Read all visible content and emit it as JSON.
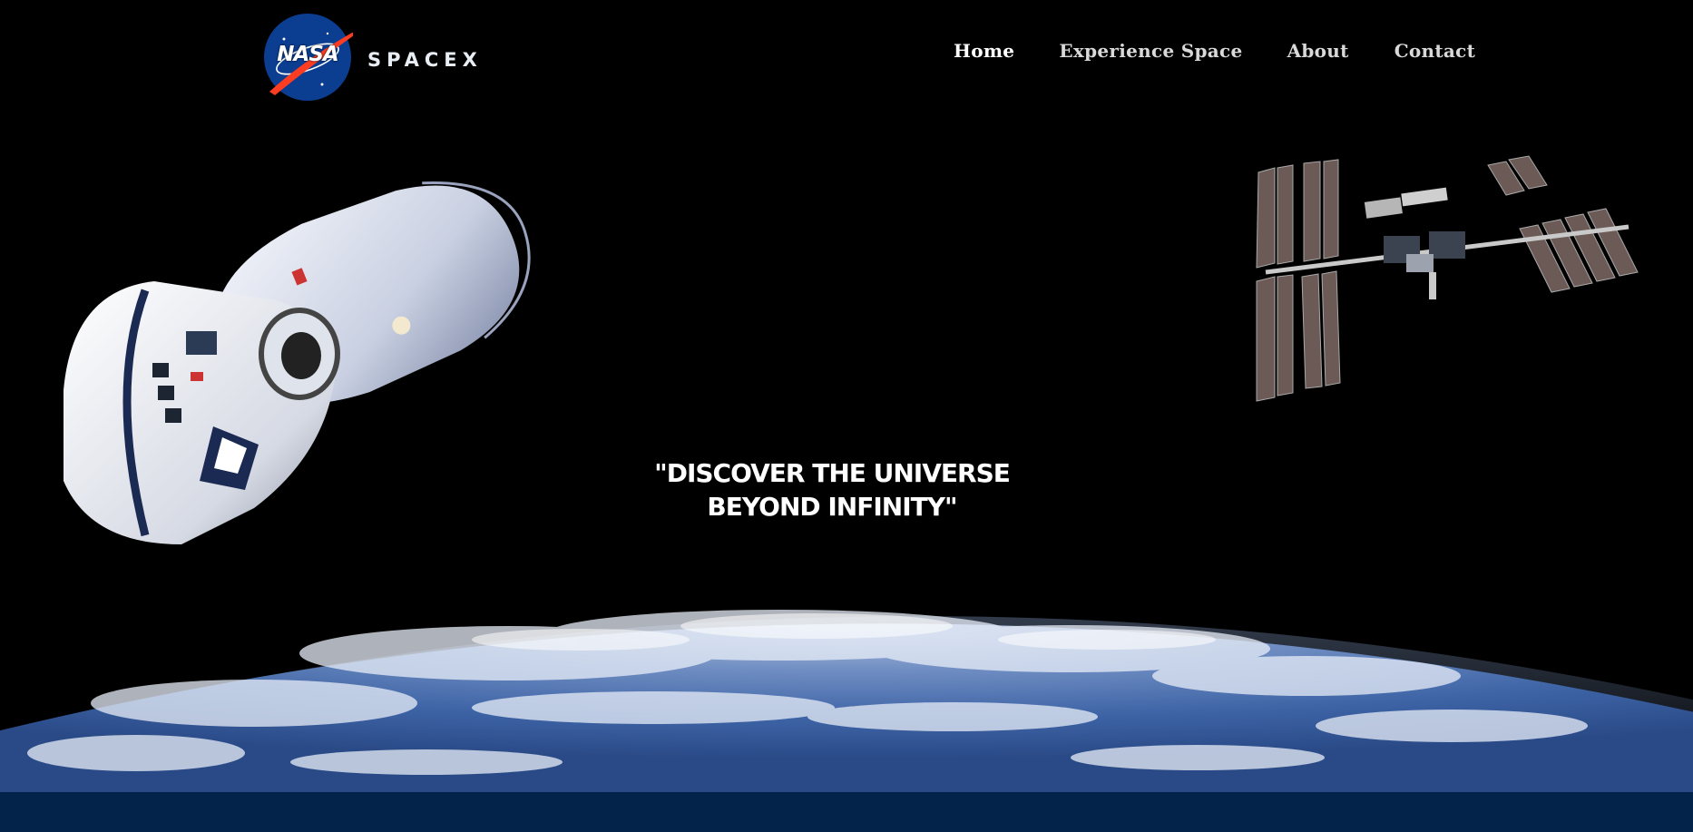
{
  "brand": {
    "nasa_logo_text": "NASA",
    "spacex_logo_text": "SPACEX"
  },
  "nav": {
    "items": [
      {
        "label": "Home",
        "active": true
      },
      {
        "label": "Experience Space",
        "active": false
      },
      {
        "label": "About",
        "active": false
      },
      {
        "label": "Contact",
        "active": false
      }
    ]
  },
  "hero": {
    "tagline_line1": "\"DISCOVER THE UNIVERSE",
    "tagline_line2": "BEYOND INFINITY\""
  },
  "icons": {
    "capsules": "spacecraft-capsules-illustration",
    "station": "space-station-illustration",
    "earth": "earth-horizon-illustration"
  },
  "colors": {
    "background": "#000000",
    "footer_band": "#03234a",
    "nav_text": "#d9d9d9",
    "nav_active": "#ffffff",
    "nasa_blue": "#0b3d91",
    "nasa_red": "#fc3d21"
  }
}
